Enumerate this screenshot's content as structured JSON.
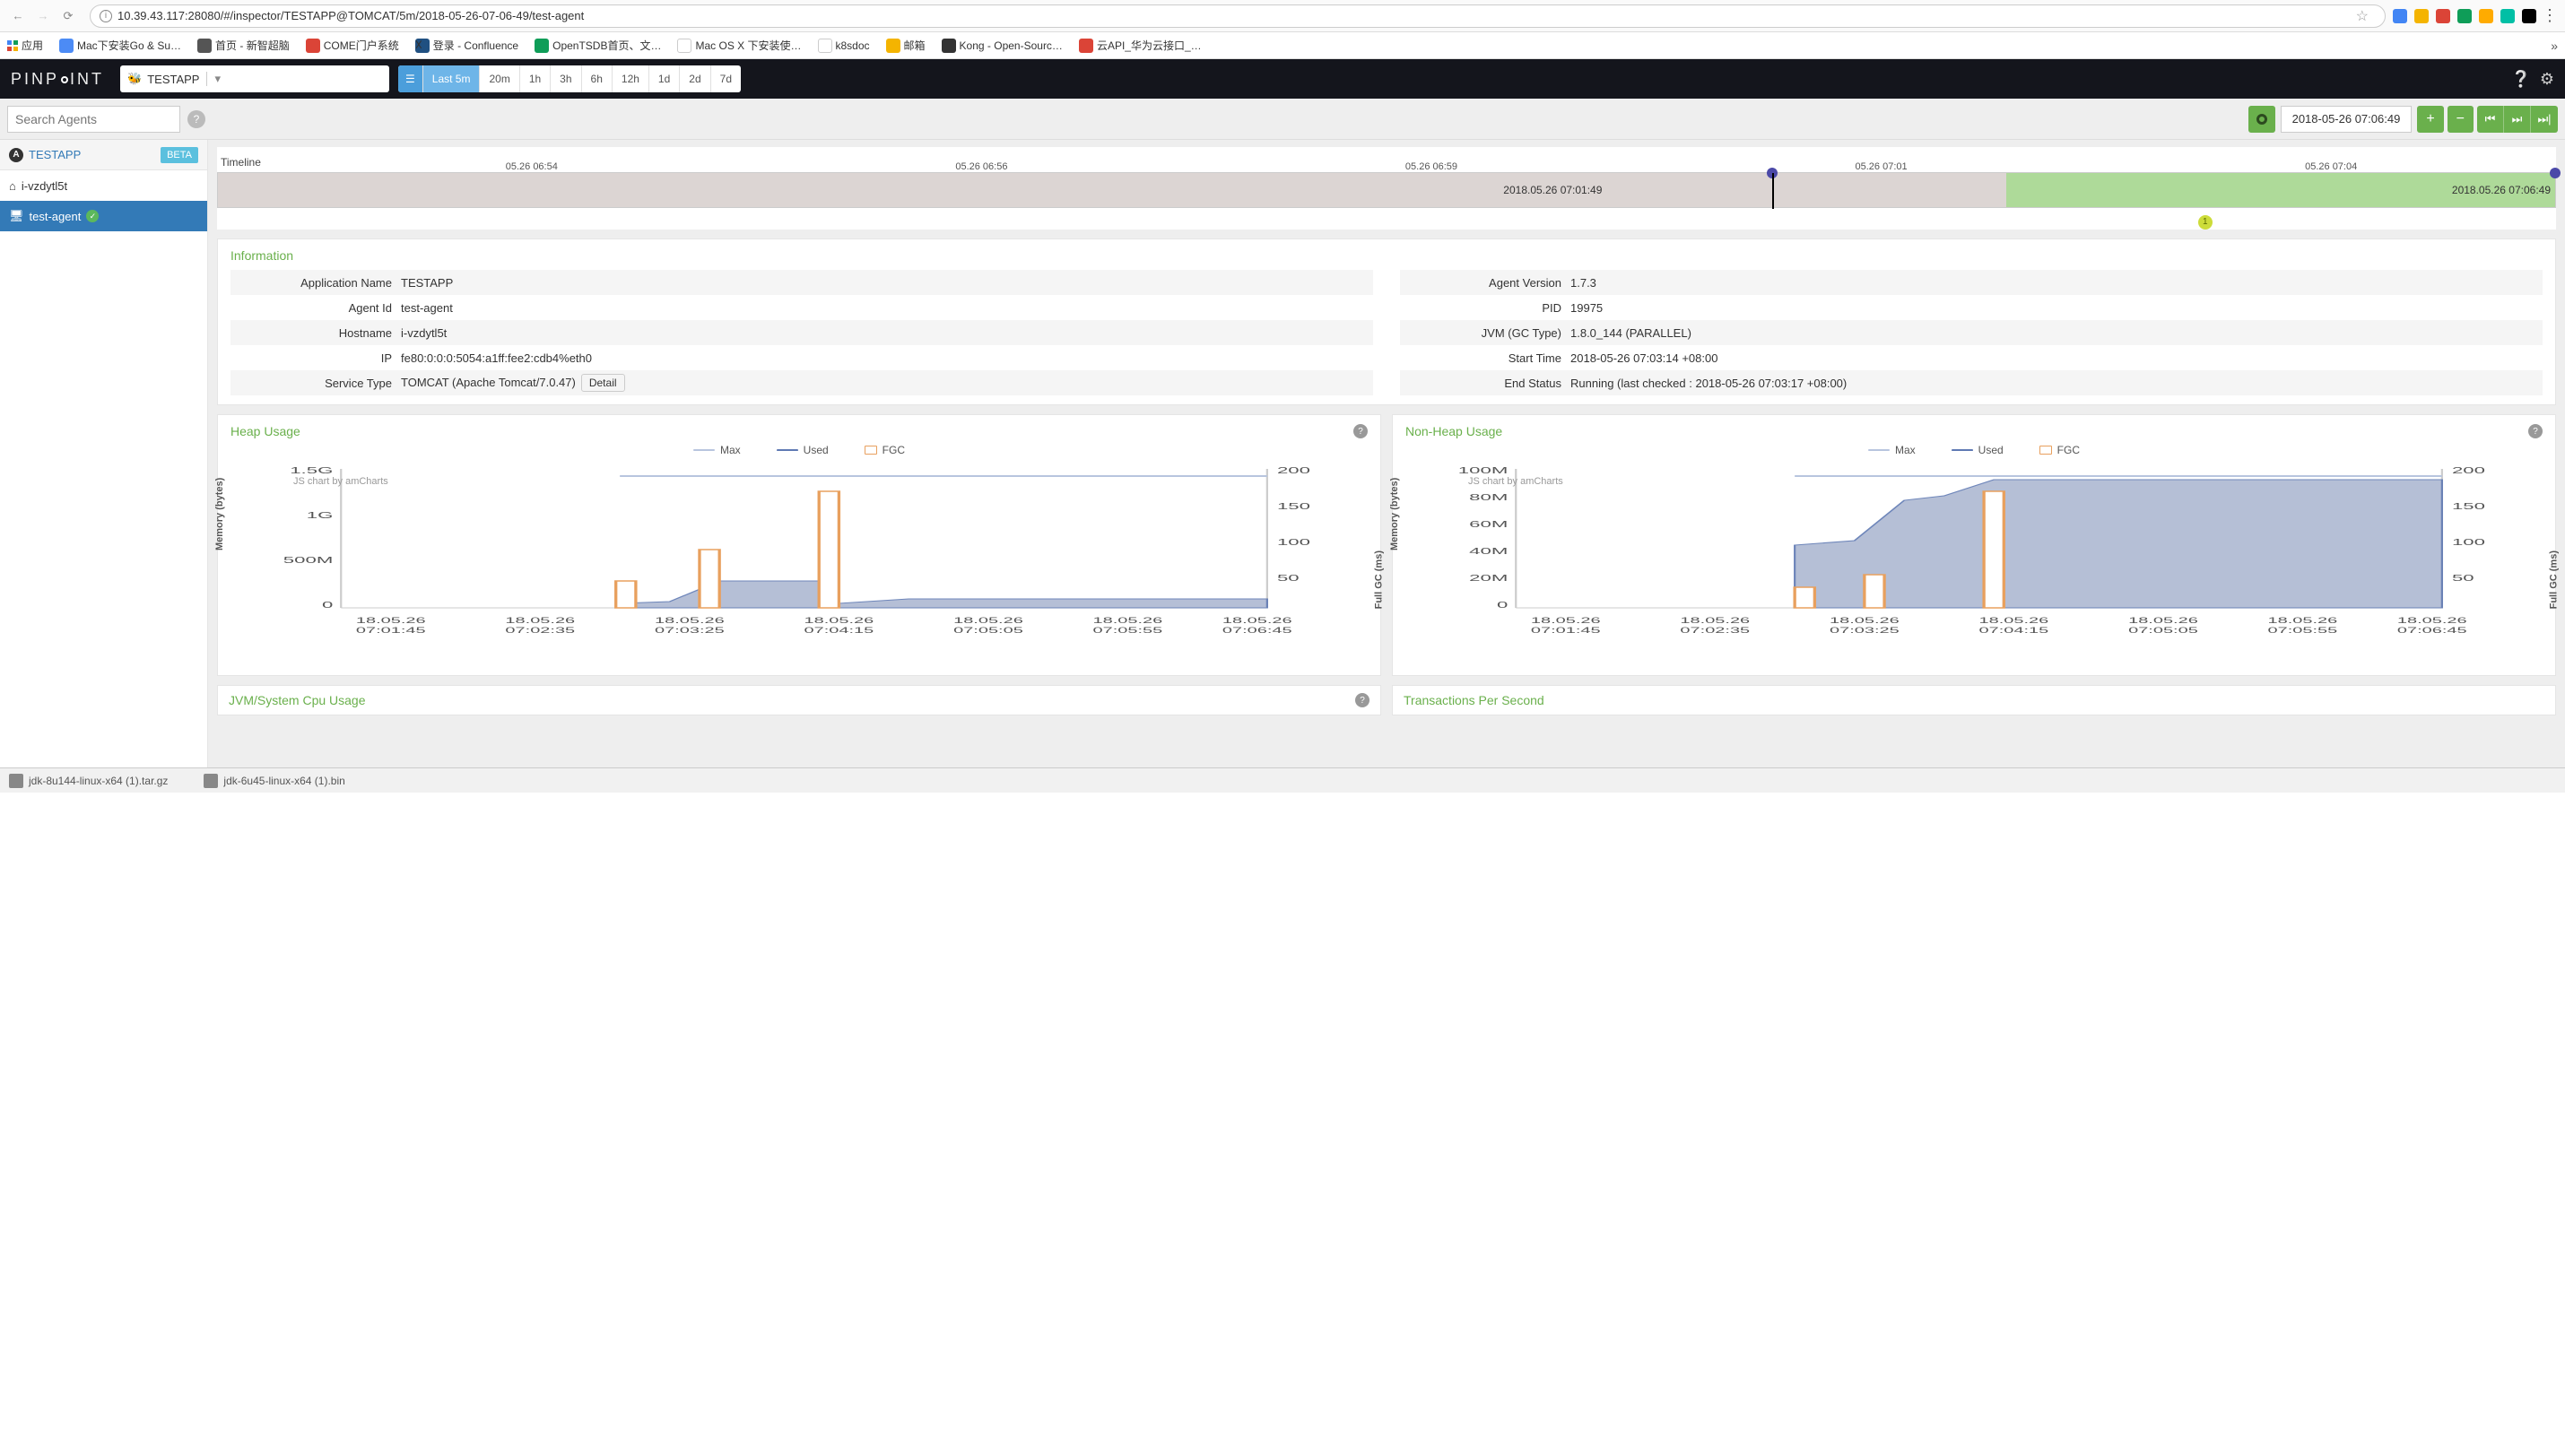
{
  "browser": {
    "url": "10.39.43.117:28080/#/inspector/TESTAPP@TOMCAT/5m/2018-05-26-07-06-49/test-agent",
    "bookmarks": [
      "应用",
      "Mac下安装Go & Su…",
      "首页 - 新智超脑",
      "COME门户系统",
      "登录 - Confluence",
      "OpenTSDB首页、文…",
      "Mac OS X 下安装使…",
      "k8sdoc",
      "邮箱",
      "Kong - Open-Sourc…",
      "云API_华为云接口_…"
    ]
  },
  "header": {
    "logo": "PINP   INT",
    "app": "TESTAPP",
    "ranges": [
      "Last 5m",
      "20m",
      "1h",
      "3h",
      "6h",
      "12h",
      "1d",
      "2d",
      "7d"
    ],
    "active_range": 0
  },
  "toolbar": {
    "search_placeholder": "Search Agents",
    "datetime": "2018-05-26 07:06:49"
  },
  "sidebar": {
    "app": "TESTAPP",
    "beta": "BETA",
    "host": "i-vzdytl5t",
    "agent": "test-agent"
  },
  "timeline": {
    "label": "Timeline",
    "ticks": [
      "05.26 06:54",
      "05.26 06:56",
      "05.26 06:59",
      "05.26 07:01",
      "05.26 07:04"
    ],
    "left_ts": "2018.05.26 07:01:49",
    "right_ts": "2018.05.26 07:06:49",
    "badge": "1"
  },
  "info": {
    "title": "Information",
    "left": {
      "Application Name": "TESTAPP",
      "Agent Id": "test-agent",
      "Hostname": "i-vzdytl5t",
      "IP": "fe80:0:0:0:5054:a1ff:fee2:cdb4%eth0",
      "Service Type": "TOMCAT  (Apache Tomcat/7.0.47)"
    },
    "detail_btn": "Detail",
    "right": {
      "Agent Version": "1.7.3",
      "PID": "19975",
      "JVM (GC Type)": "1.8.0_144 (PARALLEL)",
      "Start Time": "2018-05-26 07:03:14 +08:00",
      "End Status": "Running (last checked : 2018-05-26 07:03:17 +08:00)"
    }
  },
  "charts": {
    "heap": {
      "title": "Heap Usage",
      "ylabel": "Memory (bytes)",
      "y2label": "Full GC (ms)",
      "legend": [
        "Max",
        "Used",
        "FGC"
      ],
      "watermark": "JS chart by amCharts"
    },
    "nonheap": {
      "title": "Non-Heap Usage",
      "ylabel": "Memory (bytes)",
      "y2label": "Full GC (ms)",
      "legend": [
        "Max",
        "Used",
        "FGC"
      ],
      "watermark": "JS chart by amCharts"
    },
    "bottom": [
      "JVM/System Cpu Usage",
      "Transactions Per Second"
    ]
  },
  "chart_data": [
    {
      "type": "mixed",
      "title": "Heap Usage",
      "x": [
        "18.05.26 07:01:45",
        "18.05.26 07:02:35",
        "18.05.26 07:03:25",
        "18.05.26 07:04:15",
        "18.05.26 07:05:05",
        "18.05.26 07:05:55",
        "18.05.26 07:06:45"
      ],
      "series": [
        {
          "name": "Max",
          "type": "line",
          "values": [
            null,
            null,
            1400000000,
            1400000000,
            1400000000,
            1400000000,
            1400000000
          ]
        },
        {
          "name": "Used",
          "type": "area",
          "values": [
            null,
            null,
            60000000,
            250000000,
            250000000,
            130000000,
            130000000
          ]
        },
        {
          "name": "FGC",
          "type": "bar",
          "y2": true,
          "values": [
            null,
            null,
            40,
            90,
            170,
            null,
            null
          ]
        }
      ],
      "ylim": [
        0,
        1500000000
      ],
      "yticks": [
        "0",
        "500M",
        "1G",
        "1.5G"
      ],
      "y2lim": [
        0,
        200
      ],
      "y2ticks": [
        "50",
        "100",
        "150",
        "200"
      ]
    },
    {
      "type": "mixed",
      "title": "Non-Heap Usage",
      "x": [
        "18.05.26 07:01:45",
        "18.05.26 07:02:35",
        "18.05.26 07:03:25",
        "18.05.26 07:04:15",
        "18.05.26 07:05:05",
        "18.05.26 07:05:55",
        "18.05.26 07:06:45"
      ],
      "series": [
        {
          "name": "Max",
          "type": "line",
          "values": [
            null,
            null,
            95000000,
            95000000,
            95000000,
            95000000,
            95000000
          ]
        },
        {
          "name": "Used",
          "type": "area",
          "values": [
            null,
            null,
            45000000,
            80000000,
            95000000,
            95000000,
            95000000
          ]
        },
        {
          "name": "FGC",
          "type": "bar",
          "y2": true,
          "values": [
            null,
            null,
            30,
            50,
            170,
            null,
            null
          ]
        }
      ],
      "ylim": [
        0,
        100000000
      ],
      "yticks": [
        "0",
        "20M",
        "40M",
        "60M",
        "80M",
        "100M"
      ],
      "y2lim": [
        0,
        200
      ],
      "y2ticks": [
        "50",
        "100",
        "150",
        "200"
      ]
    }
  ],
  "downloads": [
    "jdk-8u144-linux-x64 (1).tar.gz",
    "jdk-6u45-linux-x64 (1).bin"
  ]
}
